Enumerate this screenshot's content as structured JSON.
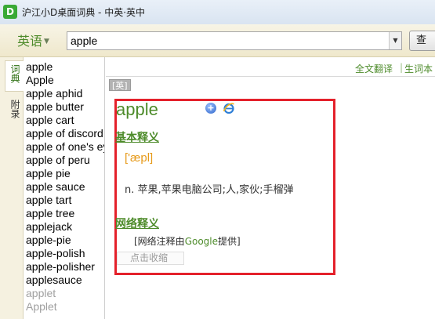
{
  "window": {
    "title": "沪江小D桌面词典 - 中英·英中",
    "logo_letter": "D"
  },
  "search": {
    "language_label": "英语",
    "query": "apple",
    "query_button_label": "查"
  },
  "side_tabs": [
    {
      "label": "词典",
      "active": true
    },
    {
      "label": "附录",
      "active": false
    }
  ],
  "word_list": [
    "apple",
    "Apple",
    "apple aphid",
    "apple butter",
    "apple cart",
    "apple of discord",
    "apple of one's eye",
    "apple of peru",
    "apple pie",
    "apple sauce",
    "apple tart",
    "apple tree",
    "applejack",
    "apple-pie",
    "apple-polish",
    "apple-polisher",
    "applesauce",
    "applet",
    "Applet"
  ],
  "toolbar_links": {
    "full_translate": "全文翻译",
    "separator": "|",
    "vocab_book": "生词本"
  },
  "entry": {
    "source_tag": "[英]",
    "headword": "apple",
    "basic_heading": "基本释义",
    "phonetic": "['æpl]",
    "definition": "n. 苹果,苹果电脑公司;人,家伙;手榴弹",
    "web_heading": "网络释义",
    "web_note_prefix": "[网络注释由",
    "web_note_brand": "Google",
    "web_note_suffix": "提供]",
    "collapse_label": "点击收缩"
  },
  "colors": {
    "accent": "#4d8b2a",
    "highlight_border": "#e4212b",
    "phonetic": "#e69a1a"
  }
}
